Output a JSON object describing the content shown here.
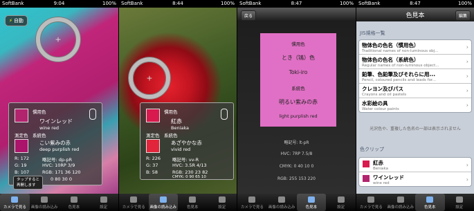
{
  "status_bars": [
    {
      "carrier": "SoftBank",
      "time": "9:04",
      "battery": "100%"
    },
    {
      "carrier": "SoftBank",
      "time": "8:44",
      "battery": "100%"
    },
    {
      "carrier": "SoftBank",
      "time": "8:47",
      "battery": "100%"
    },
    {
      "carrier": "SoftBank",
      "time": "8:47",
      "battery": "100%"
    }
  ],
  "tabs": {
    "camera": "カメラで見る",
    "image": "画像の読み込み",
    "colorbook": "色見本",
    "settings": "設定"
  },
  "screen1": {
    "auto_label": "自動",
    "tooltip": "タップすると\n再開します",
    "common_label": "慣用色",
    "common_jp": "ワインレッド",
    "common_en": "wine red",
    "measured_label": "測定色",
    "system_label": "系統色",
    "system_jp": "こい紫みの赤",
    "system_en": "deep purplish red",
    "r": "R: 172",
    "g": "G: 19",
    "b": "B: 107",
    "abbr": "略記号: dp-pR",
    "hvc": "HVC: 10RP 3/9",
    "rgb": "RGB: 171 36 120",
    "cmyk": "0 80 30 0",
    "common_color": "#b3246f",
    "measured_color": "#ac136b"
  },
  "screen2": {
    "common_label": "慣用色",
    "common_jp": "紅赤",
    "common_en": "Beniaka",
    "measured_label": "測定色",
    "system_label": "系統色",
    "system_jp": "あざやかな赤",
    "system_en": "vivid red",
    "r": "R: 226",
    "g": "G: 37",
    "b": "B: 58",
    "abbr": "略記号: vv-R",
    "hvc": "HVC: 3.5R 4/13",
    "rgb": "RGB: 230 23 82",
    "cmyk": "CMYK: 0 90 65 10",
    "common_color": "#d81a4e",
    "measured_color": "#e2253a"
  },
  "screen3": {
    "back": "戻る",
    "card_color": "#e070c5",
    "card_lines": [
      "慣用色",
      "とき（鴇）色",
      "Toki-iro",
      "系統色",
      "明るい紫みの赤",
      "light purplish red"
    ],
    "abbr": "略記号: lt-pR",
    "hvc": "HVC: 7RP 7.5/8",
    "cmyk": "CMYK: 0 40 10 0",
    "rgb": "RGB: 255 153 220"
  },
  "screen4": {
    "title": "色見本",
    "edit": "編集",
    "section1": "JIS規格一覧",
    "items": [
      {
        "title": "物体色の色名（慣用色）",
        "sub": "Traditional names of non-luminous obj..."
      },
      {
        "title": "物体色の色名（系統色）",
        "sub": "Regular names of non-luminous object..."
      },
      {
        "title": "鉛筆、色鉛筆及びそれらに用...",
        "sub": "Pencil, coloured pencils and leads for..."
      },
      {
        "title": "クレヨン及びパス",
        "sub": "Crayons and oil pastels"
      },
      {
        "title": "水彩絵の具",
        "sub": "Water colour paints"
      }
    ],
    "note": "光沢色や、重複した色名の一部は表示されません",
    "section2": "色クリップ",
    "clips": [
      {
        "title": "紅赤",
        "sub": "Beniaka",
        "color": "#d81a4e"
      },
      {
        "title": "ワインレッド",
        "sub": "wine red",
        "color": "#b3246f"
      }
    ]
  }
}
